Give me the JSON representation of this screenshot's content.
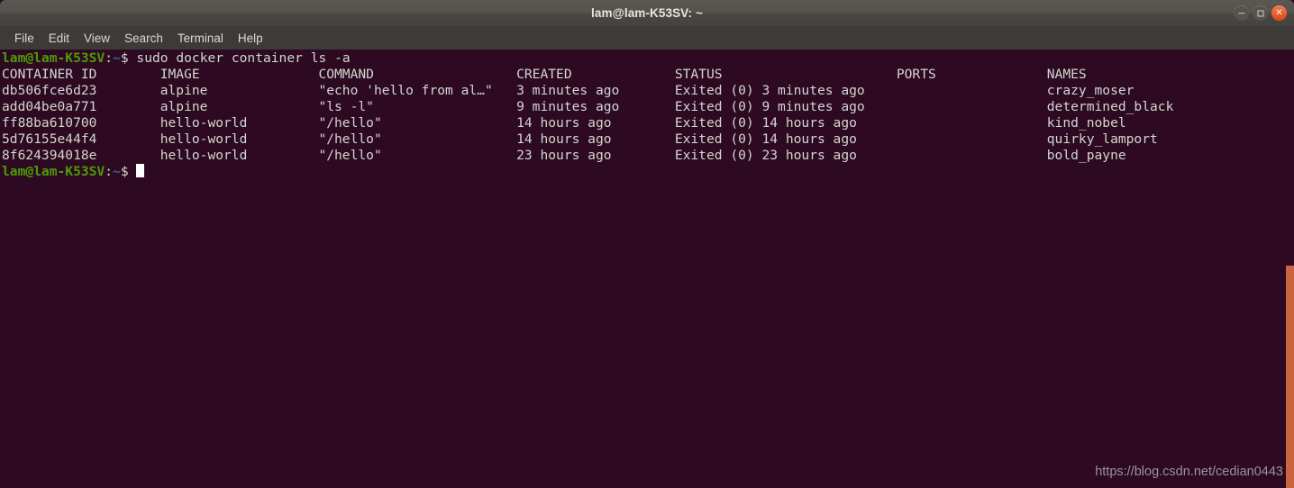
{
  "window": {
    "title": "lam@lam-K53SV: ~",
    "controls": {
      "minimize": "minimize",
      "maximize": "maximize",
      "close": "close"
    }
  },
  "menubar": {
    "items": [
      {
        "label": "File"
      },
      {
        "label": "Edit"
      },
      {
        "label": "View"
      },
      {
        "label": "Search"
      },
      {
        "label": "Terminal"
      },
      {
        "label": "Help"
      }
    ]
  },
  "terminal": {
    "prompt": {
      "user_host": "lam@lam-K53SV",
      "colon": ":",
      "path": "~",
      "sigil": "$"
    },
    "command": "sudo docker container ls -a",
    "headers": {
      "container_id": "CONTAINER ID",
      "image": "IMAGE",
      "command": "COMMAND",
      "created": "CREATED",
      "status": "STATUS",
      "ports": "PORTS",
      "names": "NAMES"
    },
    "rows": [
      {
        "container_id": "db506fce6d23",
        "image": "alpine",
        "command": "\"echo 'hello from al…\"",
        "created": "3 minutes ago",
        "status": "Exited (0) 3 minutes ago",
        "ports": "",
        "names": "crazy_moser"
      },
      {
        "container_id": "add04be0a771",
        "image": "alpine",
        "command": "\"ls -l\"",
        "created": "9 minutes ago",
        "status": "Exited (0) 9 minutes ago",
        "ports": "",
        "names": "determined_black"
      },
      {
        "container_id": "ff88ba610700",
        "image": "hello-world",
        "command": "\"/hello\"",
        "created": "14 hours ago",
        "status": "Exited (0) 14 hours ago",
        "ports": "",
        "names": "kind_nobel"
      },
      {
        "container_id": "5d76155e44f4",
        "image": "hello-world",
        "command": "\"/hello\"",
        "created": "14 hours ago",
        "status": "Exited (0) 14 hours ago",
        "ports": "",
        "names": "quirky_lamport"
      },
      {
        "container_id": "8f624394018e",
        "image": "hello-world",
        "command": "\"/hello\"",
        "created": "23 hours ago",
        "status": "Exited (0) 23 hours ago",
        "ports": "",
        "names": "bold_payne"
      }
    ],
    "columns": {
      "container_id": 0,
      "image": 20,
      "command": 40,
      "created": 65,
      "status": 85,
      "ports": 113,
      "names": 132
    }
  },
  "watermark": {
    "text": "https://blog.csdn.net/cedian0443"
  },
  "colors": {
    "terminal_background": "#2d0922",
    "terminal_foreground": "#d3d7cf",
    "prompt_green": "#4e9a06",
    "prompt_blue": "#3465a4",
    "titlebar": "#4f4c47",
    "menubar": "#3c3b37",
    "close_button": "#dd4814",
    "scrollbar": "#cb6440"
  }
}
